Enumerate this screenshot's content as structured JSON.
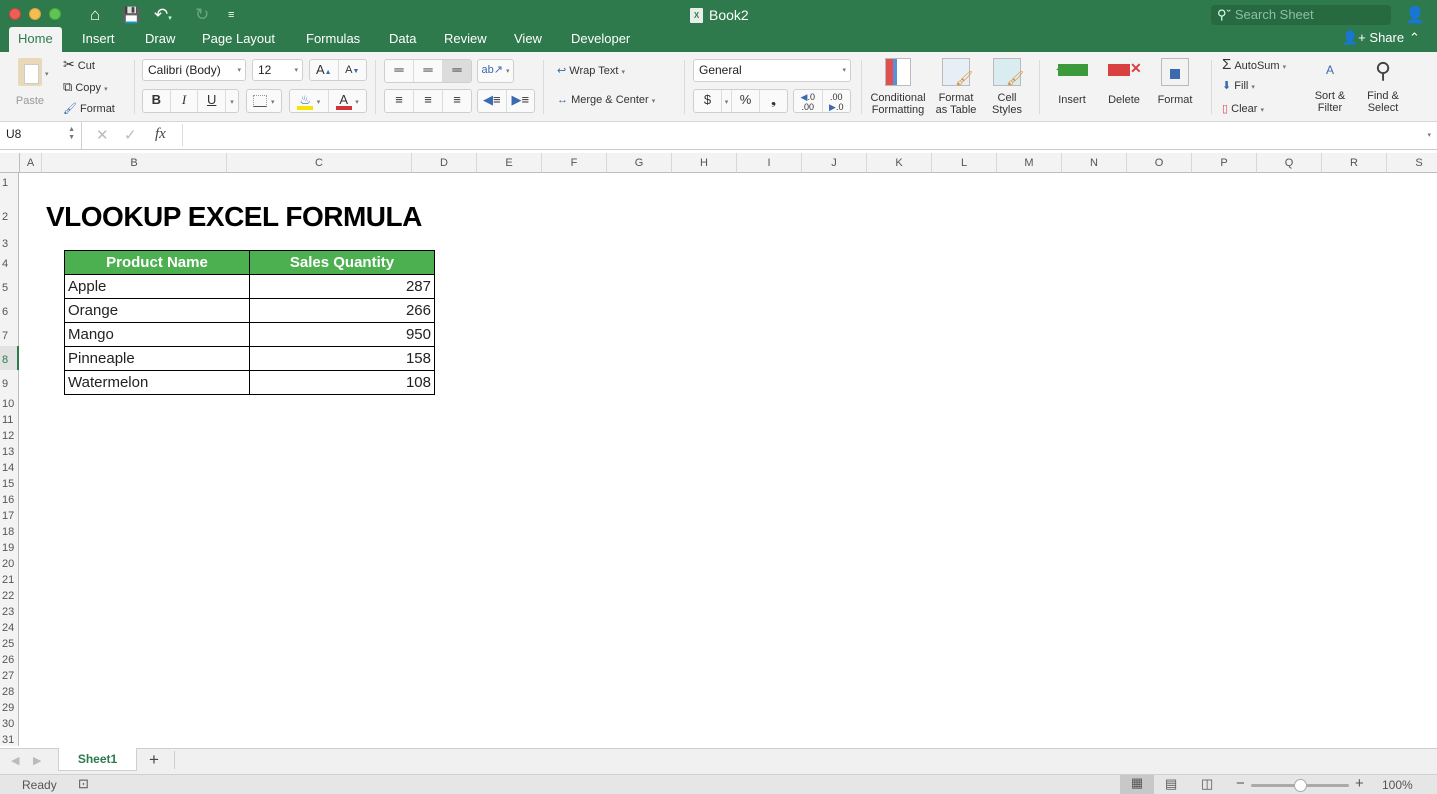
{
  "window": {
    "title": "Book2",
    "search_placeholder": "Search Sheet"
  },
  "quick_access": {
    "home": "home-icon",
    "save": "save-icon",
    "undo": "undo-icon",
    "redo": "redo-icon",
    "customize": "customize-icon"
  },
  "tabs": [
    "Home",
    "Insert",
    "Draw",
    "Page Layout",
    "Formulas",
    "Data",
    "Review",
    "View",
    "Developer"
  ],
  "active_tab": "Home",
  "share_label": "Share",
  "ribbon": {
    "paste": "Paste",
    "cut": "Cut",
    "copy": "Copy",
    "format_painter": "Format",
    "font_name": "Calibri (Body)",
    "font_size": "12",
    "bold": "B",
    "italic": "I",
    "underline": "U",
    "wrap_text": "Wrap Text",
    "merge_center": "Merge & Center",
    "number_format": "General",
    "currency": "$",
    "percent": "%",
    "comma": "❟",
    "conditional_formatting": [
      "Conditional",
      "Formatting"
    ],
    "format_as_table": [
      "Format",
      "as Table"
    ],
    "cell_styles": [
      "Cell",
      "Styles"
    ],
    "insert": "Insert",
    "delete": "Delete",
    "format": "Format",
    "autosum": "AutoSum",
    "fill": "Fill",
    "clear": "Clear",
    "sort_filter": [
      "Sort &",
      "Filter"
    ],
    "find_select": [
      "Find &",
      "Select"
    ],
    "colors": {
      "fill_color": "#f5e400",
      "font_color": "#d13438"
    }
  },
  "formula_bar": {
    "name_box": "U8",
    "fx": "fx",
    "value": ""
  },
  "columns": [
    "A",
    "B",
    "C",
    "D",
    "E",
    "F",
    "G",
    "H",
    "I",
    "J",
    "K",
    "L",
    "M",
    "N",
    "O",
    "P",
    "Q",
    "R",
    "S"
  ],
  "rows": [
    "1",
    "2",
    "3",
    "4",
    "5",
    "6",
    "7",
    "8",
    "9",
    "10",
    "11",
    "12",
    "13",
    "14",
    "15",
    "16",
    "17",
    "18",
    "19",
    "20",
    "21",
    "22",
    "23",
    "24",
    "25",
    "26",
    "27",
    "28",
    "29",
    "30",
    "31"
  ],
  "selected_row": "8",
  "sheet": {
    "title": "VLOOKUP EXCEL FORMULA",
    "table": {
      "headers": [
        "Product Name",
        "Sales Quantity"
      ],
      "header_color": "#4caf50",
      "rows": [
        {
          "name": "Apple",
          "qty": "287"
        },
        {
          "name": "Orange",
          "qty": "266"
        },
        {
          "name": "Mango",
          "qty": "950"
        },
        {
          "name": "Pinneaple",
          "qty": "158"
        },
        {
          "name": "Watermelon",
          "qty": "108"
        }
      ]
    }
  },
  "sheet_tabs": [
    "Sheet1"
  ],
  "add_sheet": "+",
  "status": {
    "ready": "Ready",
    "zoom": "100%",
    "zoom_level_percent": 100
  }
}
